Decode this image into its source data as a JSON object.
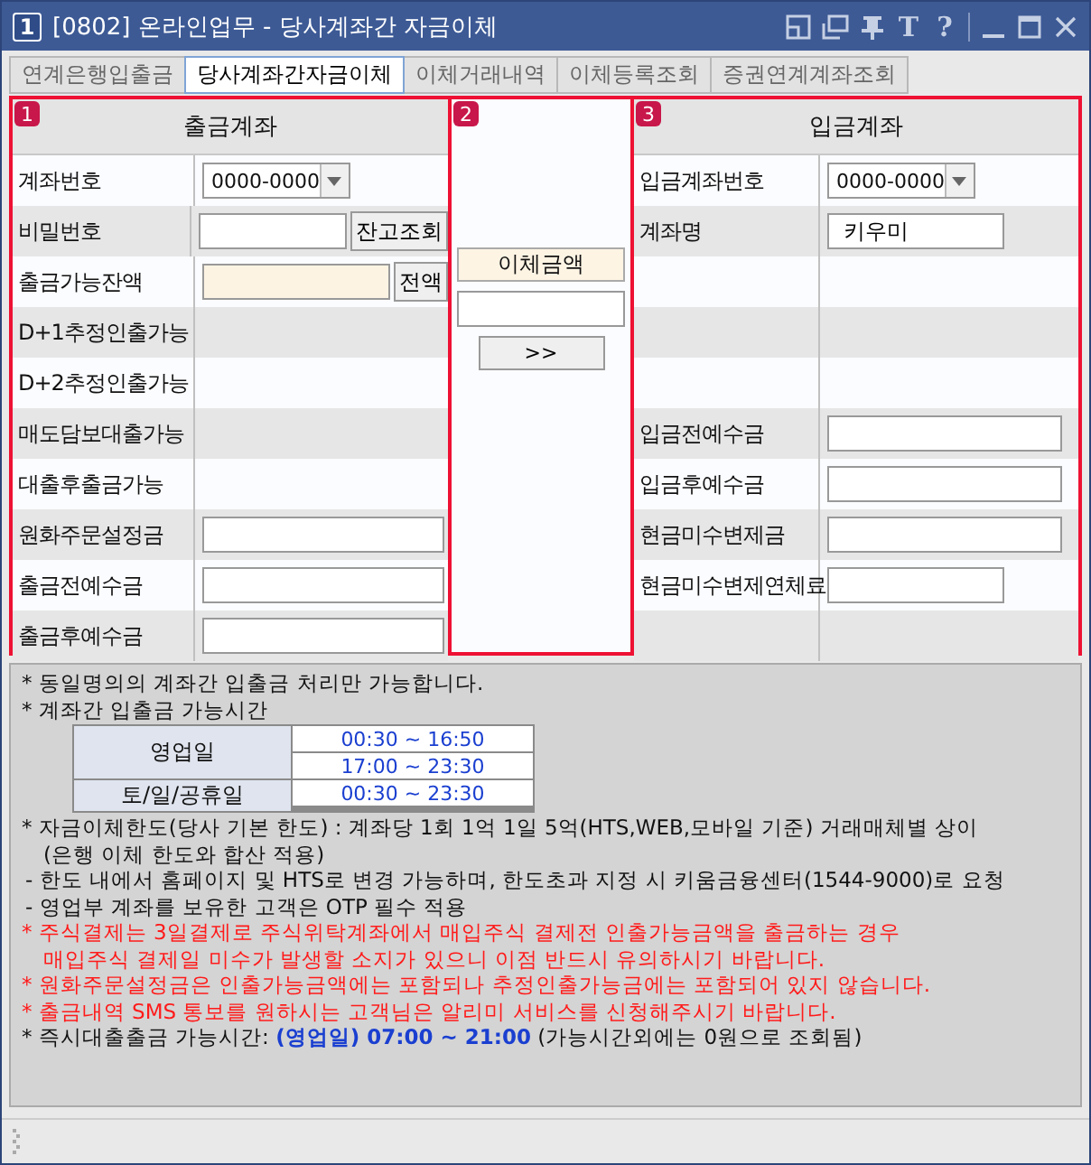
{
  "window": {
    "badge": "1",
    "title": "[0802] 온라인업무 - 당사계좌간 자금이체",
    "controls": [
      {
        "kind": "layout"
      },
      {
        "kind": "windows"
      },
      {
        "kind": "pin"
      },
      {
        "kind": "glyph",
        "text": "T"
      },
      {
        "kind": "glyph",
        "text": "?"
      },
      {
        "kind": "divider"
      },
      {
        "kind": "minimize"
      },
      {
        "kind": "maximize"
      },
      {
        "kind": "close"
      }
    ]
  },
  "tabs": [
    {
      "label": "연계은행입출금",
      "selected": false
    },
    {
      "label": "당사계좌간자금이체",
      "selected": true
    },
    {
      "label": "이체거래내역",
      "selected": false
    },
    {
      "label": "이체등록조회",
      "selected": false
    },
    {
      "label": "증권연계계좌조회",
      "selected": false
    }
  ],
  "withdraw_panel": {
    "badge": "1",
    "title": "출금계좌",
    "rows": [
      {
        "label": "계좌번호",
        "kind": "select",
        "value": "0000-0000"
      },
      {
        "label": "비밀번호",
        "kind": "input_button",
        "button": "잔고조회"
      },
      {
        "label": "출금가능잔액",
        "kind": "amount_button",
        "button": "전액"
      },
      {
        "label": "D+1추정인출가능",
        "kind": "label_only"
      },
      {
        "label": "D+2추정인출가능",
        "kind": "label_only"
      },
      {
        "label": "매도담보대출가능",
        "kind": "label_only"
      },
      {
        "label": "대출후출금가능",
        "kind": "label_only"
      },
      {
        "label": "원화주문설정금",
        "kind": "input"
      },
      {
        "label": "출금전예수금",
        "kind": "input"
      },
      {
        "label": "출금후예수금",
        "kind": "input"
      }
    ]
  },
  "transfer_panel": {
    "badge": "2",
    "amount_label": "이체금액",
    "button": ">>"
  },
  "deposit_panel": {
    "badge": "3",
    "title": "입금계좌",
    "rows": [
      {
        "label": "입금계좌번호",
        "kind": "select",
        "value": "0000-0000"
      },
      {
        "label": "계좌명",
        "kind": "short_input",
        "value": "키우미"
      },
      {
        "kind": "blank"
      },
      {
        "kind": "blank"
      },
      {
        "kind": "blank"
      },
      {
        "label": "입금전예수금",
        "kind": "input"
      },
      {
        "label": "입금후예수금",
        "kind": "input"
      },
      {
        "label": "현금미수변제금",
        "kind": "input"
      },
      {
        "label": "현금미수변제연체료",
        "kind": "short_input"
      },
      {
        "kind": "blank"
      }
    ]
  },
  "notes": [
    {
      "kind": "note",
      "text": "* 동일명의의 계좌간 입출금 처리만 가능합니다."
    },
    {
      "kind": "note",
      "text": "* 계좌간 입출금 가능시간"
    },
    {
      "kind": "schedule",
      "rows": [
        {
          "day": "영업일",
          "times": [
            "00:30 ~ 16:50",
            "17:00 ~ 23:30"
          ]
        },
        {
          "day": "토/일/공휴일",
          "times": [
            "00:30 ~ 23:30"
          ]
        }
      ]
    },
    {
      "kind": "note",
      "text": "* 자금이체한도(당사 기본 한도) : 계좌당 1회 1억 1일 5억(HTS,WEB,모바일 기준) 거래매체별 상이"
    },
    {
      "kind": "continuation",
      "text": "(은행 이체 한도와 합산 적용)"
    },
    {
      "kind": "sub",
      "text": "- 한도 내에서 홈페이지 및 HTS로 변경 가능하며, 한도초과 지정 시 키움금융센터(1544-9000)로 요청"
    },
    {
      "kind": "sub",
      "text": "- 영업부 계좌를 보유한 고객은 OTP 필수 적용"
    },
    {
      "kind": "warning",
      "text": "* 주식결제는 3일결제로 주식위탁계좌에서 매입주식 결제전 인출가능금액을 출금하는 경우"
    },
    {
      "kind": "warning_continuation",
      "text": "매입주식 결제일 미수가 발생할 소지가 있으니 이점 반드시 유의하시기 바랍니다."
    },
    {
      "kind": "warning",
      "text": "* 원화주문설정금은 인출가능금액에는 포함되나 추정인출가능금에는 포함되어 있지 않습니다."
    },
    {
      "kind": "warning",
      "text": "* 출금내역 SMS 통보를 원하시는 고객님은 알리미 서비스를 신청해주시기 바랍니다."
    },
    {
      "kind": "rich_note",
      "text": "* 즉시대출출금 가능시간: **(영업일) 07:00 ~ 21:00** (가능시간외에는 0원으로 조회됨)"
    }
  ]
}
